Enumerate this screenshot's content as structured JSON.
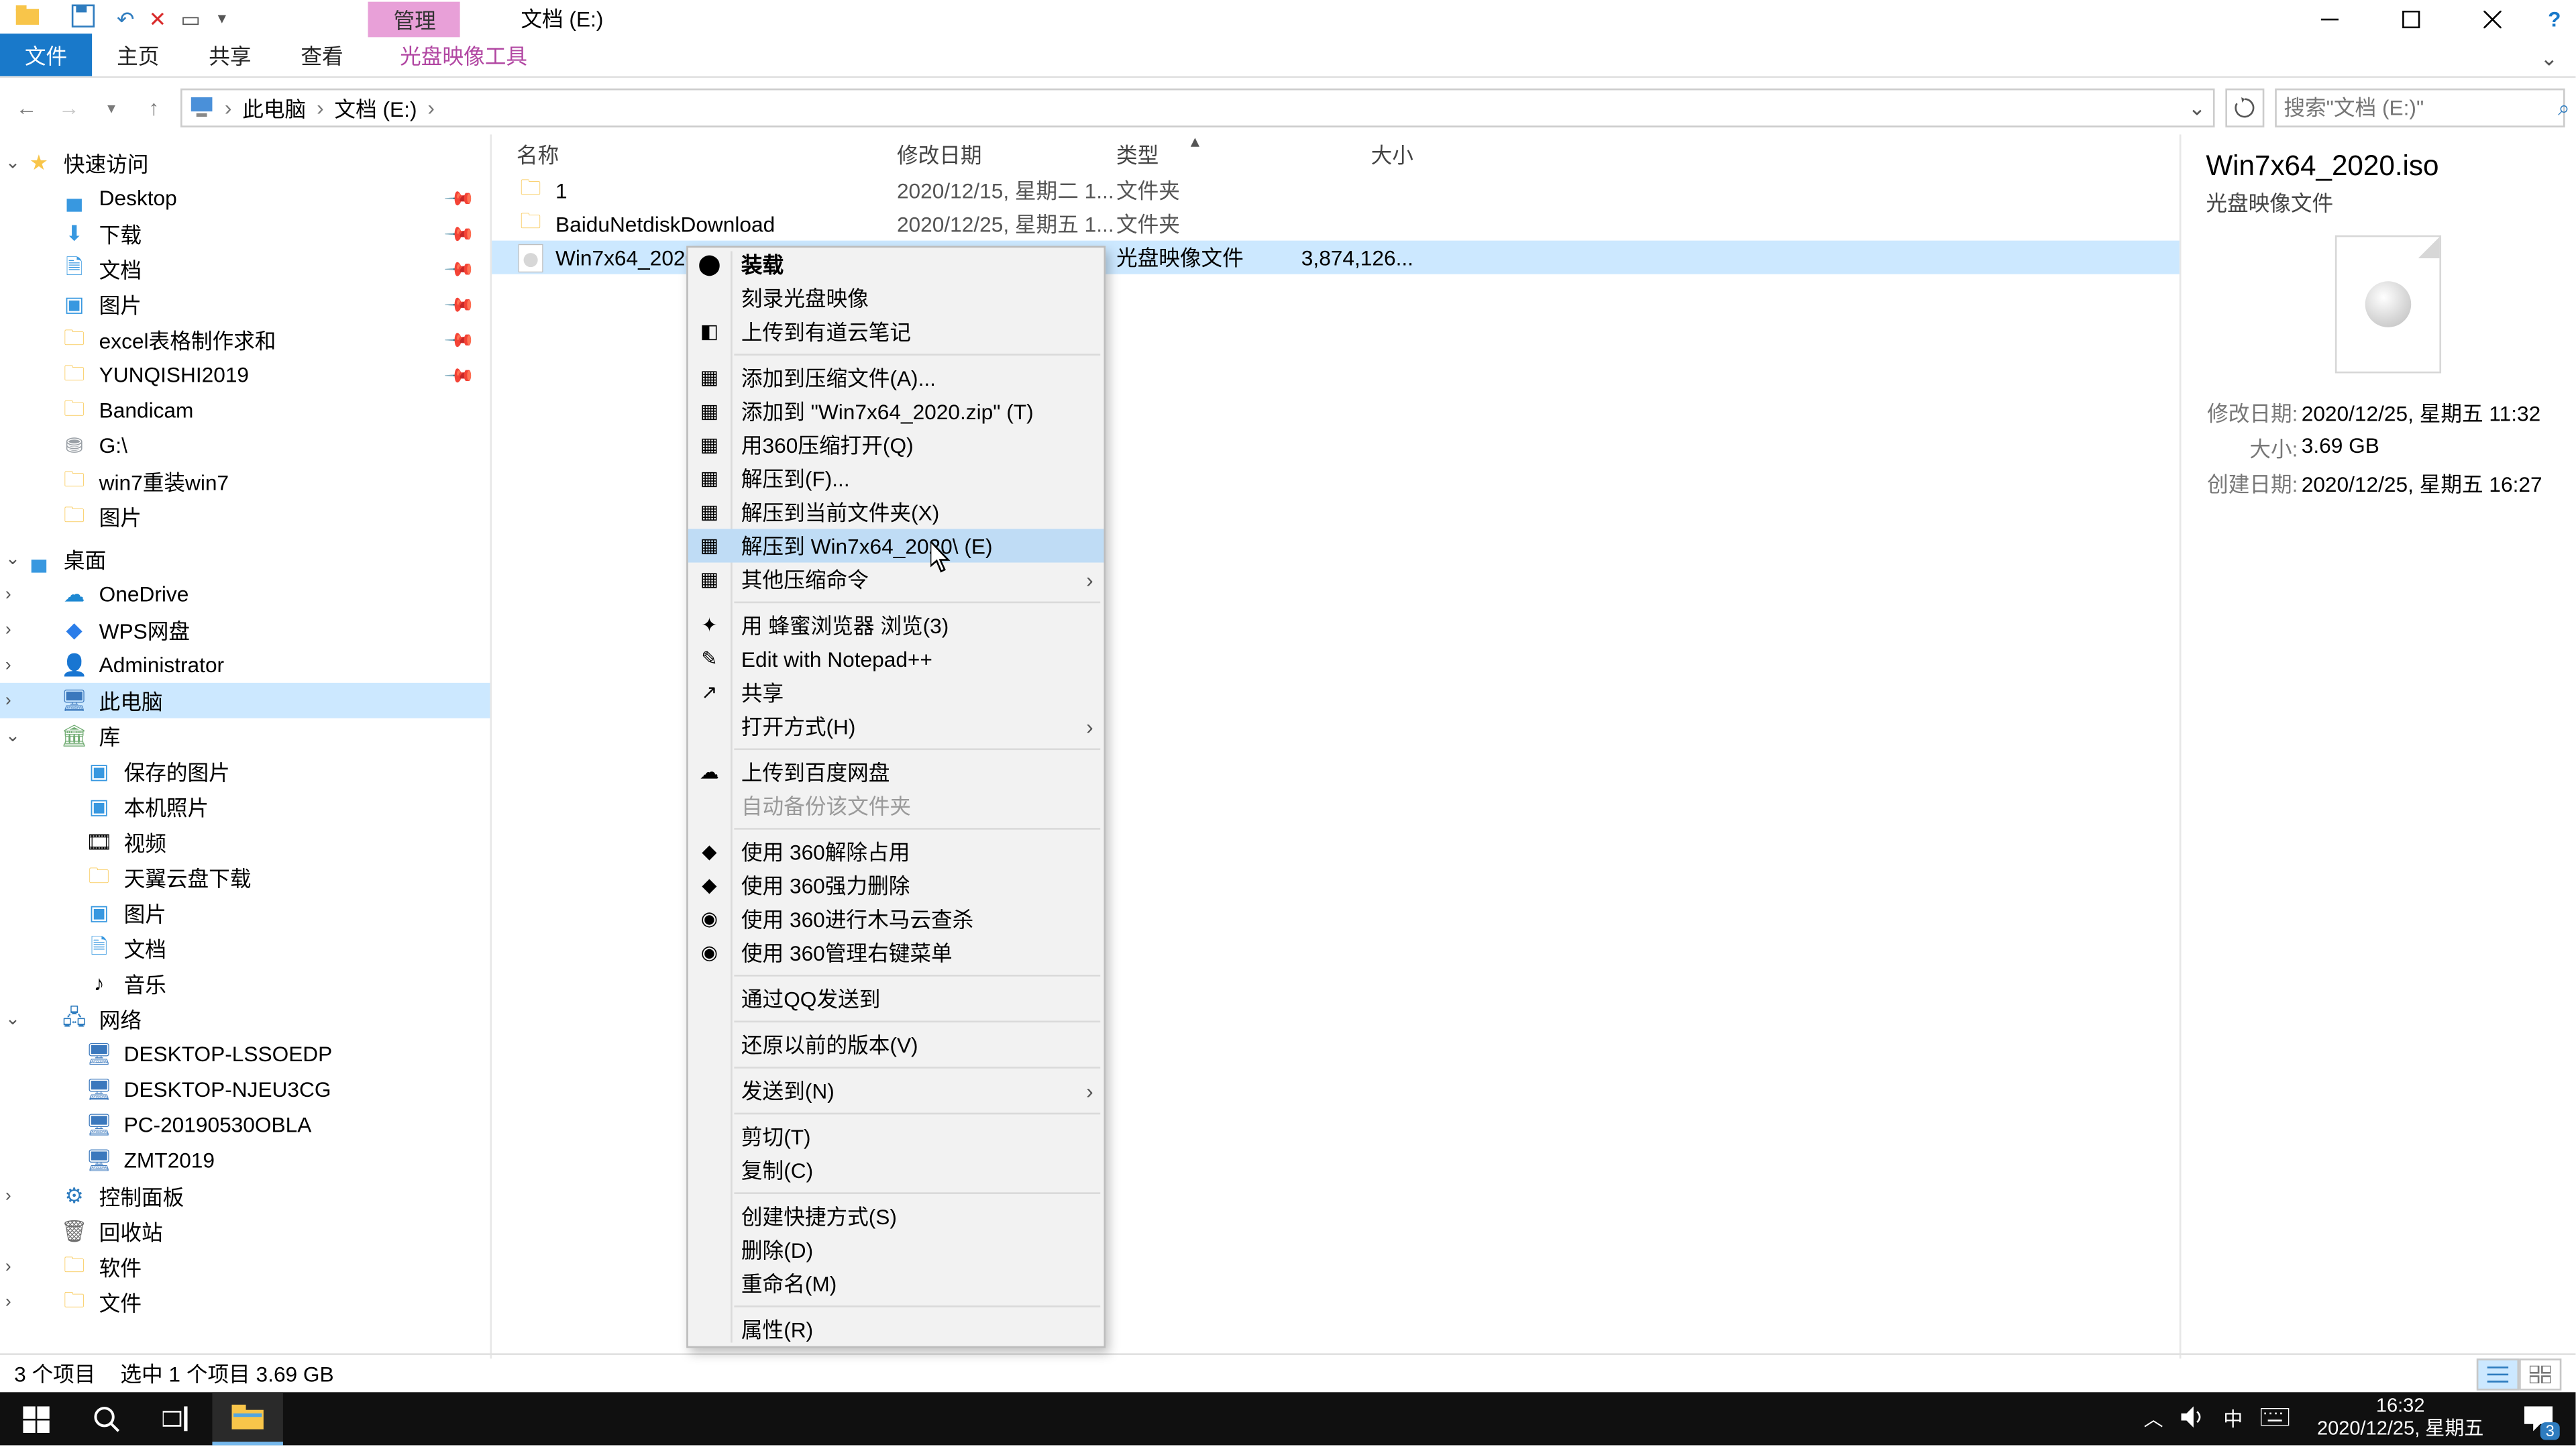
{
  "window": {
    "title_context_tab": "管理",
    "title_text": "文档 (E:)",
    "min": "—",
    "max": "▢",
    "close": "✕"
  },
  "ribbon": {
    "file": "文件",
    "home": "主页",
    "share": "共享",
    "view": "查看",
    "tools": "光盘映像工具"
  },
  "address": {
    "crumb1": "此电脑",
    "crumb2": "文档 (E:)",
    "search_placeholder": "搜索\"文档 (E:)\""
  },
  "nav": {
    "quick_access": "快速访问",
    "desktop": "Desktop",
    "downloads": "下载",
    "documents": "文档",
    "pictures": "图片",
    "excel": "excel表格制作求和",
    "yunqishi": "YUNQISHI2019",
    "bandicam": "Bandicam",
    "gdrive": "G:\\",
    "win7reinstall": "win7重装win7",
    "pictures2": "图片",
    "desktop_group": "桌面",
    "onedrive": "OneDrive",
    "wps": "WPS网盘",
    "admin": "Administrator",
    "thispc": "此电脑",
    "lib": "库",
    "saved_pics": "保存的图片",
    "camera_roll": "本机照片",
    "videos": "视频",
    "tianyi": "天翼云盘下载",
    "pictures3": "图片",
    "documents2": "文档",
    "music": "音乐",
    "network": "网络",
    "pc1": "DESKTOP-LSSOEDP",
    "pc2": "DESKTOP-NJEU3CG",
    "pc3": "PC-20190530OBLA",
    "pc4": "ZMT2019",
    "control_panel": "控制面板",
    "recycle": "回收站",
    "software": "软件",
    "files": "文件"
  },
  "columns": {
    "name": "名称",
    "date": "修改日期",
    "type": "类型",
    "size": "大小"
  },
  "rows": [
    {
      "name": "1",
      "date": "2020/12/15, 星期二 1...",
      "type": "文件夹",
      "size": "",
      "icon": "folder"
    },
    {
      "name": "BaiduNetdiskDownload",
      "date": "2020/12/25, 星期五 1...",
      "type": "文件夹",
      "size": "",
      "icon": "folder"
    },
    {
      "name": "Win7x64_2020.iso",
      "date": "",
      "type": "光盘映像文件",
      "size": "3,874,126...",
      "icon": "iso",
      "selected": true
    }
  ],
  "context_menu": [
    {
      "label": "装载",
      "icon": "⬤",
      "bold": true
    },
    {
      "label": "刻录光盘映像"
    },
    {
      "label": "上传到有道云笔记",
      "icon": "◧"
    },
    {
      "sep": true
    },
    {
      "label": "添加到压缩文件(A)...",
      "icon": "▦"
    },
    {
      "label": "添加到 \"Win7x64_2020.zip\" (T)",
      "icon": "▦"
    },
    {
      "label": "用360压缩打开(Q)",
      "icon": "▦"
    },
    {
      "label": "解压到(F)...",
      "icon": "▦"
    },
    {
      "label": "解压到当前文件夹(X)",
      "icon": "▦"
    },
    {
      "label": "解压到 Win7x64_2020\\ (E)",
      "icon": "▦",
      "highlight": true
    },
    {
      "label": "其他压缩命令",
      "icon": "▦",
      "submenu": true
    },
    {
      "sep": true
    },
    {
      "label": "用 蜂蜜浏览器 浏览(3)",
      "icon": "✦"
    },
    {
      "label": "Edit with Notepad++",
      "icon": "✎"
    },
    {
      "label": "共享",
      "icon": "↗"
    },
    {
      "label": "打开方式(H)",
      "submenu": true
    },
    {
      "sep": true
    },
    {
      "label": "上传到百度网盘",
      "icon": "☁"
    },
    {
      "label": "自动备份该文件夹",
      "disabled": true
    },
    {
      "sep": true
    },
    {
      "label": "使用 360解除占用",
      "icon": "◆"
    },
    {
      "label": "使用 360强力删除",
      "icon": "◆"
    },
    {
      "label": "使用 360进行木马云查杀",
      "icon": "◉"
    },
    {
      "label": "使用 360管理右键菜单",
      "icon": "◉"
    },
    {
      "sep": true
    },
    {
      "label": "通过QQ发送到"
    },
    {
      "sep": true
    },
    {
      "label": "还原以前的版本(V)"
    },
    {
      "sep": true
    },
    {
      "label": "发送到(N)",
      "submenu": true
    },
    {
      "sep": true
    },
    {
      "label": "剪切(T)"
    },
    {
      "label": "复制(C)"
    },
    {
      "sep": true
    },
    {
      "label": "创建快捷方式(S)"
    },
    {
      "label": "删除(D)"
    },
    {
      "label": "重命名(M)"
    },
    {
      "sep": true
    },
    {
      "label": "属性(R)"
    }
  ],
  "details": {
    "title": "Win7x64_2020.iso",
    "subtitle": "光盘映像文件",
    "modified_k": "修改日期:",
    "modified_v": "2020/12/25, 星期五 11:32",
    "size_k": "大小:",
    "size_v": "3.69 GB",
    "created_k": "创建日期:",
    "created_v": "2020/12/25, 星期五 16:27"
  },
  "status": {
    "items": "3 个项目",
    "selection": "选中 1 个项目  3.69 GB"
  },
  "taskbar": {
    "ime": "中",
    "time": "16:32",
    "date": "2020/12/25, 星期五",
    "notif_count": "3"
  }
}
